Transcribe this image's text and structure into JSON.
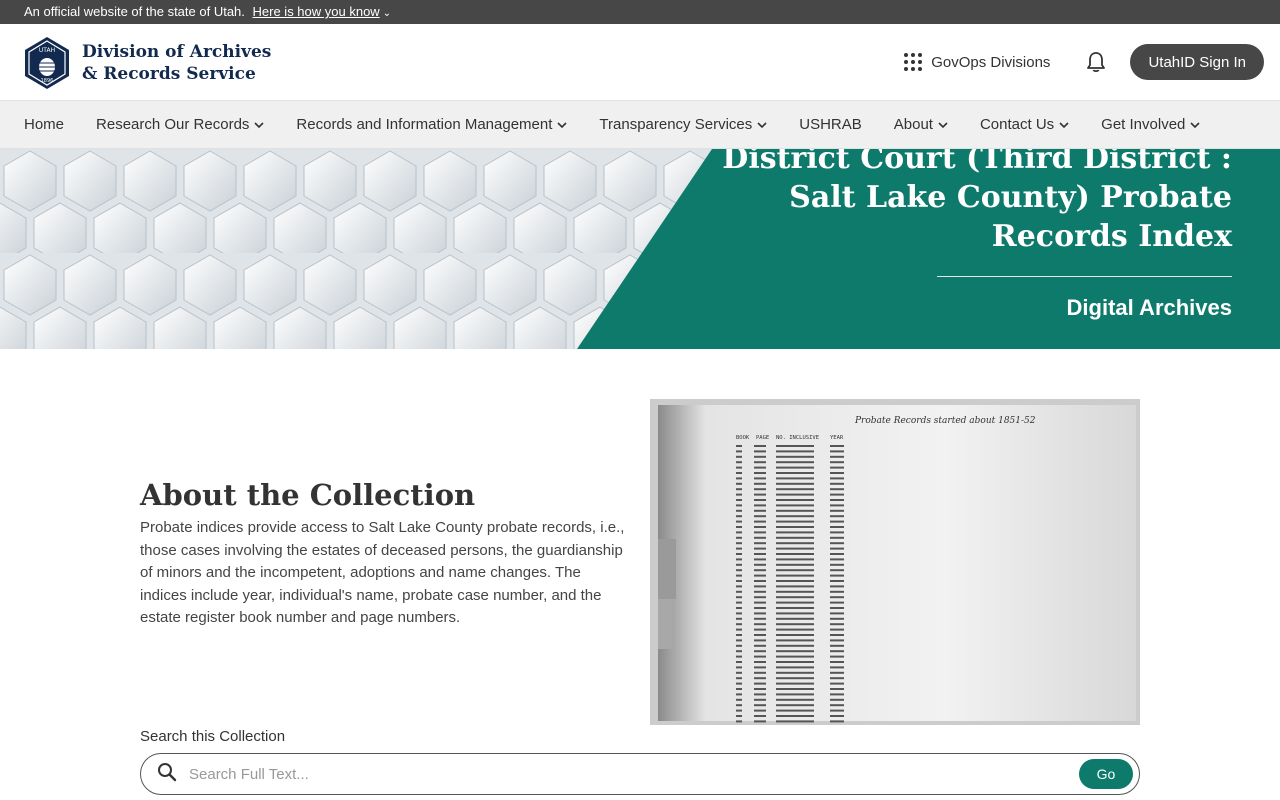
{
  "official_banner": {
    "text": "An official website of the state of Utah.",
    "link": "Here is how you know"
  },
  "header": {
    "logo_badge_top": "UTAH",
    "logo_badge_year": "1896",
    "logo_line1": "Division of Archives",
    "logo_line2": "& Records Service",
    "govops_label": "GovOps Divisions",
    "signin_label": "UtahID Sign In"
  },
  "nav": {
    "items": [
      {
        "label": "Home",
        "has_dropdown": false
      },
      {
        "label": "Research Our Records",
        "has_dropdown": true
      },
      {
        "label": "Records and Information Management",
        "has_dropdown": true
      },
      {
        "label": "Transparency Services",
        "has_dropdown": true
      },
      {
        "label": "USHRAB",
        "has_dropdown": false
      },
      {
        "label": "About",
        "has_dropdown": true
      },
      {
        "label": "Contact Us",
        "has_dropdown": true
      },
      {
        "label": "Get Involved",
        "has_dropdown": true
      }
    ]
  },
  "hero": {
    "title": "District Court (Third District : Salt Lake County) Probate Records Index",
    "subtitle": "Digital Archives"
  },
  "about": {
    "heading": "About the Collection",
    "body": "Probate indices provide access to Salt Lake County probate records, i.e., those cases involving the estates of deceased persons, the guardianship of minors and the incompetent, adoptions and name changes. The indices include year, individual's name, probate case number, and the estate register book number and page numbers."
  },
  "document_image": {
    "handwritten_note": "Probate Records started about 1851-52",
    "column_headers": [
      "BOOK",
      "PAGE",
      "NO. INCLUSIVE",
      "YEAR"
    ]
  },
  "search": {
    "label": "Search this Collection",
    "placeholder": "Search Full Text...",
    "button": "Go"
  },
  "colors": {
    "banner": "#474747",
    "navy": "#122a4f",
    "teal": "#0e7a6b",
    "nav_bg": "#f0f0f0"
  }
}
